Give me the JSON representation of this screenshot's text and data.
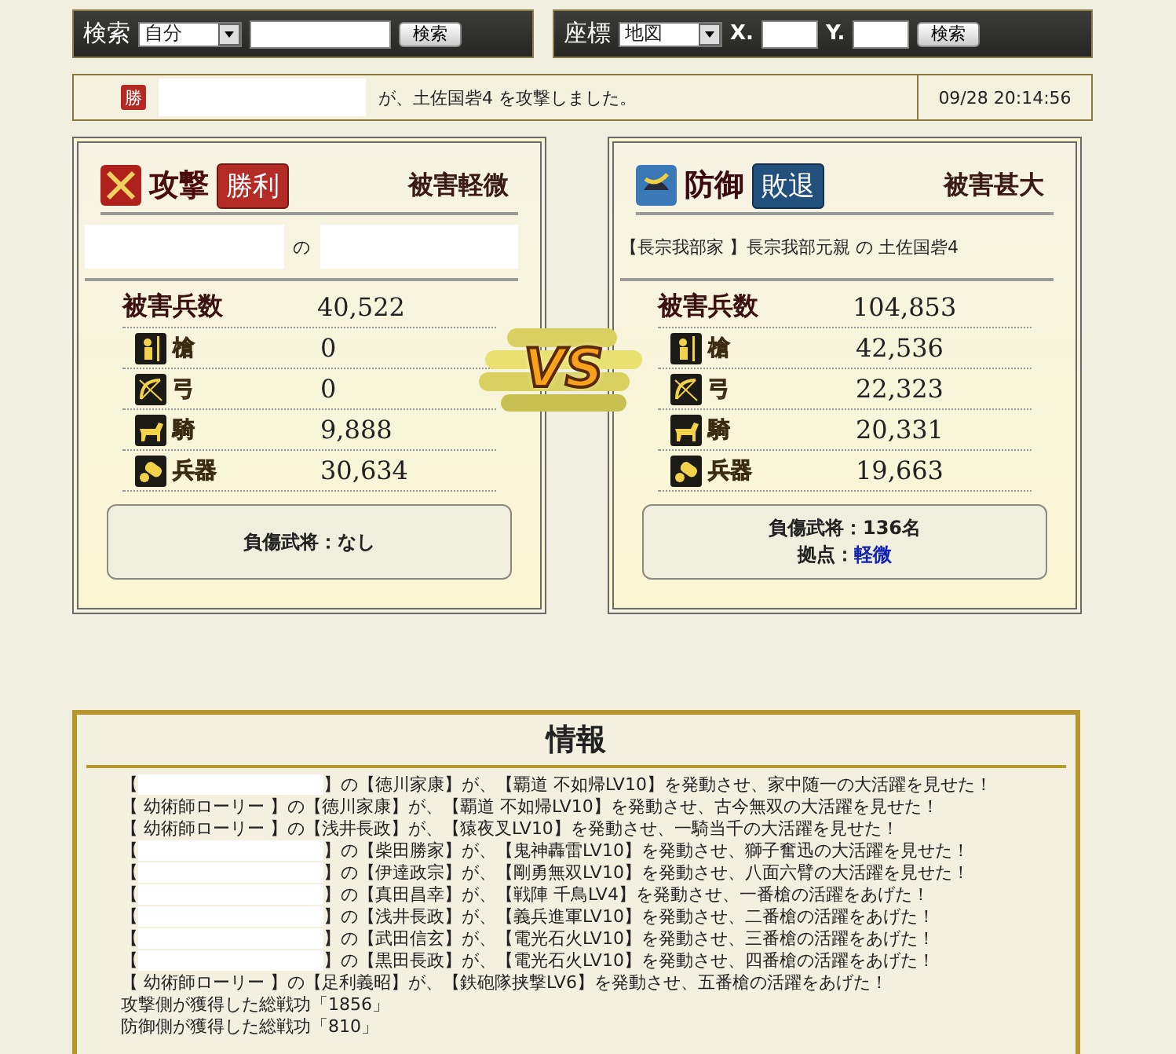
{
  "search_bar": {
    "label": "検索",
    "select": "自分",
    "button": "検索"
  },
  "coord_bar": {
    "label": "座標",
    "select": "地図",
    "x_label": "X.",
    "y_label": "Y.",
    "button": "検索"
  },
  "report": {
    "badge": "勝",
    "text": "が、土佐国砦4 を攻撃しました。",
    "time": "09/28 20:14:56"
  },
  "sides": [
    {
      "kind": "attack",
      "role": "攻撃",
      "result": "勝利",
      "damage": "被害軽微",
      "owner_parts": [
        {
          "kind": "redacted"
        },
        {
          "kind": "text",
          "text": "の"
        },
        {
          "kind": "redacted"
        }
      ],
      "total_label": "被害兵数",
      "total": "40,522",
      "units": [
        {
          "kind": "spear",
          "label": "槍",
          "value": "0"
        },
        {
          "kind": "bow",
          "label": "弓",
          "value": "0"
        },
        {
          "kind": "horse",
          "label": "騎",
          "value": "9,888"
        },
        {
          "kind": "siege",
          "label": "兵器",
          "value": "30,634"
        }
      ],
      "notes": [
        {
          "kind": "plain",
          "label": "負傷武将：",
          "value": "なし"
        }
      ]
    },
    {
      "kind": "defense",
      "role": "防御",
      "result": "敗退",
      "damage": "被害甚大",
      "owner_parts": [
        {
          "kind": "text",
          "text": "【長宗我部家 】長宗我部元親 の 土佐国砦4"
        }
      ],
      "total_label": "被害兵数",
      "total": "104,853",
      "units": [
        {
          "kind": "spear",
          "label": "槍",
          "value": "42,536"
        },
        {
          "kind": "bow",
          "label": "弓",
          "value": "22,323"
        },
        {
          "kind": "horse",
          "label": "騎",
          "value": "20,331"
        },
        {
          "kind": "siege",
          "label": "兵器",
          "value": "19,663"
        }
      ],
      "notes": [
        {
          "kind": "plain",
          "label": "負傷武将：",
          "value": "136名"
        },
        {
          "kind": "link",
          "label": "拠点：",
          "value": "軽微"
        }
      ]
    }
  ],
  "vs_logo": "VS",
  "info": {
    "title": "情報",
    "lines": [
      [
        {
          "kind": "text",
          "text": "【"
        },
        {
          "kind": "redacted"
        },
        {
          "kind": "text",
          "text": "】の【徳川家康】が、【覇道 不如帰LV10】を発動させ、家中随一の大活躍を見せた！"
        }
      ],
      [
        {
          "kind": "text",
          "text": "【 幼術師ローリー 】の【徳川家康】が、【覇道 不如帰LV10】を発動させ、古今無双の大活躍を見せた！"
        }
      ],
      [
        {
          "kind": "text",
          "text": "【 幼術師ローリー 】の【浅井長政】が、【猿夜叉LV10】を発動させ、一騎当千の大活躍を見せた！"
        }
      ],
      [
        {
          "kind": "text",
          "text": "【"
        },
        {
          "kind": "redacted"
        },
        {
          "kind": "text",
          "text": "】の【柴田勝家】が、【鬼神轟雷LV10】を発動させ、獅子奮迅の大活躍を見せた！"
        }
      ],
      [
        {
          "kind": "text",
          "text": "【"
        },
        {
          "kind": "redacted"
        },
        {
          "kind": "text",
          "text": "】の【伊達政宗】が、【剛勇無双LV10】を発動させ、八面六臂の大活躍を見せた！"
        }
      ],
      [
        {
          "kind": "text",
          "text": "【"
        },
        {
          "kind": "redacted"
        },
        {
          "kind": "text",
          "text": "】の【真田昌幸】が、【戦陣 千鳥LV4】を発動させ、一番槍の活躍をあげた！"
        }
      ],
      [
        {
          "kind": "text",
          "text": "【"
        },
        {
          "kind": "redacted"
        },
        {
          "kind": "text",
          "text": "】の【浅井長政】が、【義兵進軍LV10】を発動させ、二番槍の活躍をあげた！"
        }
      ],
      [
        {
          "kind": "text",
          "text": "【"
        },
        {
          "kind": "redacted"
        },
        {
          "kind": "text",
          "text": "】の【武田信玄】が、【電光石火LV10】を発動させ、三番槍の活躍をあげた！"
        }
      ],
      [
        {
          "kind": "text",
          "text": "【"
        },
        {
          "kind": "redacted"
        },
        {
          "kind": "text",
          "text": "】の【黒田長政】が、【電光石火LV10】を発動させ、四番槍の活躍をあげた！"
        }
      ],
      [
        {
          "kind": "text",
          "text": "【 幼術師ローリー 】の【足利義昭】が、【鉄砲隊挟撃LV6】を発動させ、五番槍の活躍をあげた！"
        }
      ],
      [
        {
          "kind": "text",
          "text": "攻撃側が獲得した総戦功「1856」"
        }
      ],
      [
        {
          "kind": "text",
          "text": "防御側が獲得した総戦功「810」"
        }
      ]
    ]
  }
}
